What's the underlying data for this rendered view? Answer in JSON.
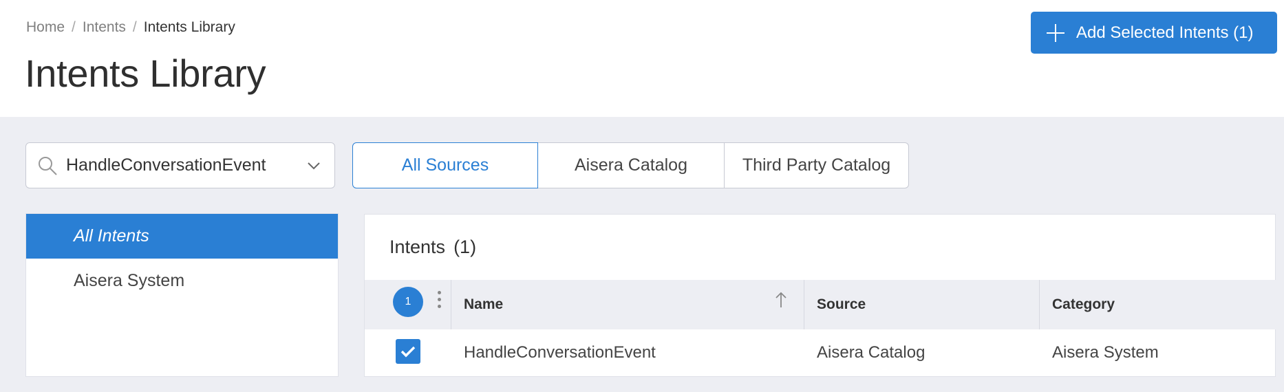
{
  "breadcrumb": {
    "items": [
      "Home",
      "Intents",
      "Intents Library"
    ],
    "separator": "/"
  },
  "page_title": "Intents Library",
  "add_button": {
    "label": "Add Selected Intents (1)",
    "icon": "plus-icon"
  },
  "search": {
    "value": "HandleConversationEvent",
    "icon": "search-icon",
    "dropdown_icon": "chevron-down-icon"
  },
  "source_tabs": [
    {
      "label": "All Sources",
      "active": true
    },
    {
      "label": "Aisera Catalog",
      "active": false
    },
    {
      "label": "Third Party Catalog",
      "active": false
    }
  ],
  "sidebar": {
    "items": [
      {
        "label": "All Intents",
        "active": true
      },
      {
        "label": "Aisera System",
        "active": false
      }
    ]
  },
  "panel": {
    "title": "Intents",
    "count": "(1)",
    "selected_badge": "1",
    "columns": {
      "name": "Name",
      "source": "Source",
      "category": "Category"
    },
    "rows": [
      {
        "name": "HandleConversationEvent",
        "source": "Aisera Catalog",
        "category": "Aisera System",
        "checked": true
      }
    ]
  },
  "colors": {
    "accent": "#2a7fd4",
    "background": "#edeef3",
    "surface": "#ffffff"
  }
}
